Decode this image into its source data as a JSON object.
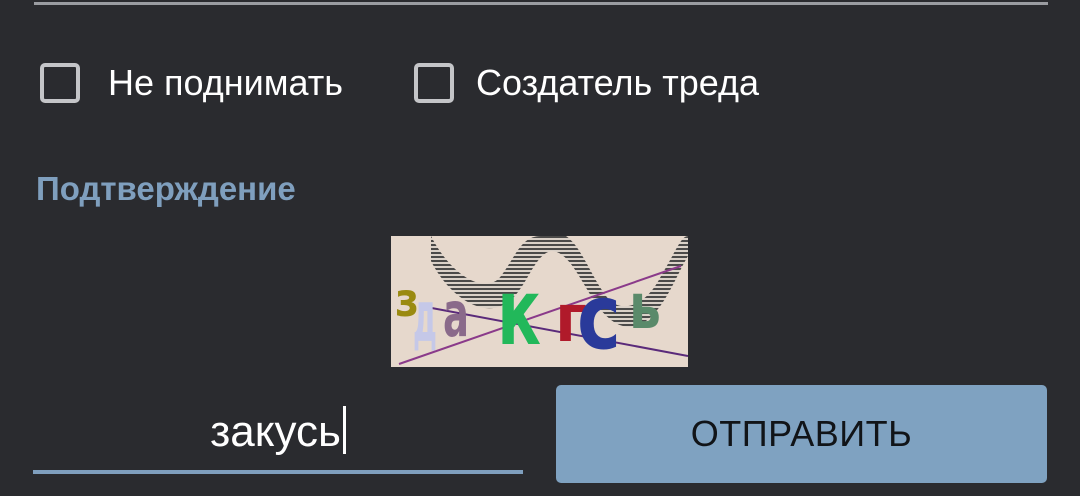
{
  "form": {
    "options": [
      {
        "label": "Не поднимать",
        "checked": false
      },
      {
        "label": "Создатель треда",
        "checked": false
      }
    ],
    "captcha_section_label": "Подтверждение",
    "captcha": {
      "characters": [
        "з",
        "д",
        "а",
        "к",
        "г",
        "с",
        "ь"
      ]
    },
    "answer_input": {
      "value": "закусь"
    },
    "submit_label": "ОТПРАВИТЬ"
  },
  "colors": {
    "background": "#2a2b2f",
    "accent": "#7f9fbe",
    "button": "#7fa2c1"
  }
}
